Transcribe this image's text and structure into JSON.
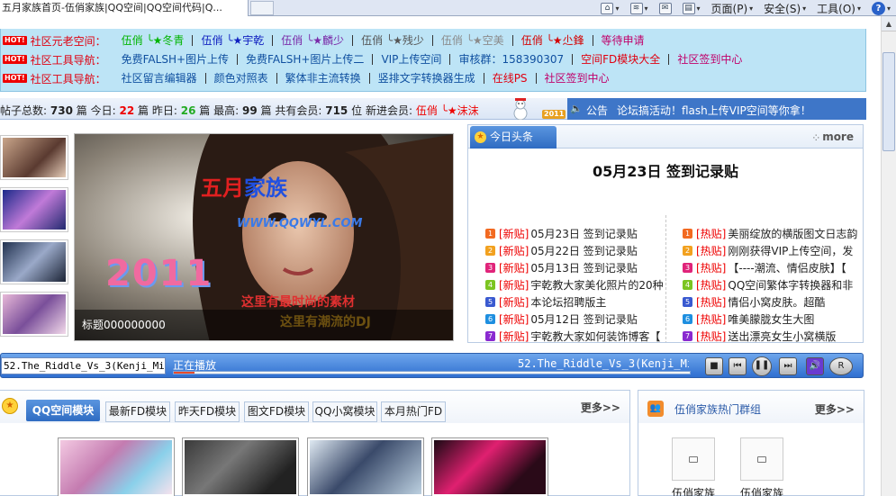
{
  "browser": {
    "tab_title": "五月家族首页-伍俏家族|QQ空间|QQ空间代码|Q...",
    "commands": {
      "home": "",
      "feeds": "",
      "read_mail": "",
      "print": "",
      "page": "页面(P)",
      "safety": "安全(S)",
      "tools": "工具(O)",
      "help": "?"
    }
  },
  "nav": {
    "hot_badge": "HOT!",
    "rows": [
      {
        "title": "社区元老空间：",
        "links": [
          {
            "text": "伍俏 ╰★冬青",
            "color": "#00b400"
          },
          {
            "text": "伍俏 ╰★宇乾",
            "color": "#1020c0"
          },
          {
            "text": "伍俏 ╰★麟少",
            "color": "#7a2aa8"
          },
          {
            "text": "伍俏 ╰★残少",
            "color": "#555555"
          },
          {
            "text": "伍俏 ╰★空美",
            "color": "#8a8a8a"
          },
          {
            "text": "伍俏 ╰★尐鋒",
            "color": "#d40000"
          },
          {
            "text": "等待申请",
            "color": "#c0006a"
          }
        ]
      },
      {
        "title": "社区工具导航：",
        "links": [
          {
            "text": "免费FALSH+图片上传",
            "color": "#1050a0"
          },
          {
            "text": "免费FALSH+图片上传二",
            "color": "#1050a0"
          },
          {
            "text": "VIP上传空间",
            "color": "#1050a0"
          },
          {
            "text": "审核群：158390307",
            "color": "#1050a0"
          },
          {
            "text": "空间FD模块大全",
            "color": "#e00010"
          },
          {
            "text": "社区签到中心",
            "color": "#c0006a"
          }
        ]
      },
      {
        "title": "社区工具导航：",
        "links": [
          {
            "text": "社区留言编辑器",
            "color": "#1050a0"
          },
          {
            "text": "颜色对照表",
            "color": "#1050a0"
          },
          {
            "text": "繁体非主流转换",
            "color": "#1050a0"
          },
          {
            "text": "竖排文字转换器生成",
            "color": "#1050a0"
          },
          {
            "text": "在线PS",
            "color": "#e00010"
          },
          {
            "text": "社区签到中心",
            "color": "#c0006a"
          }
        ]
      }
    ]
  },
  "stats": {
    "posts_label": "帖子总数:",
    "posts": "730",
    "posts_unit": "篇",
    "today_label": "今日:",
    "today": "22",
    "today_unit": "篇",
    "yesterday_label": "昨日:",
    "yesterday": "26",
    "yesterday_unit": "篇",
    "max_label": "最高:",
    "max": "99",
    "max_unit": "篇",
    "members_label": "共有会员:",
    "members": "715",
    "members_unit": "位",
    "newmember_label": "新进会员:",
    "newmember": "伍俏 ╰★沫沫"
  },
  "notice": {
    "label": "公告",
    "text": "论坛搞活动！flash上传VIP空间等你拿！"
  },
  "slideshow": {
    "caption": "标题000000000",
    "badge_year": "2011"
  },
  "headlines": {
    "tab_label": "今日头条",
    "more_label": "more",
    "feature": "05月23日 签到记录贴",
    "left": [
      {
        "num": "1",
        "color": "#f26a21",
        "tag": "[新贴]",
        "title": "05月23日 签到记录贴"
      },
      {
        "num": "2",
        "color": "#f2a11f",
        "tag": "[新贴]",
        "title": "05月22日 签到记录贴"
      },
      {
        "num": "3",
        "color": "#e0247a",
        "tag": "[新贴]",
        "title": "05月13日 签到记录贴"
      },
      {
        "num": "4",
        "color": "#7cc521",
        "tag": "[新贴]",
        "title": "宇乾教大家美化照片的20种"
      },
      {
        "num": "5",
        "color": "#3a5ad0",
        "tag": "[新贴]",
        "title": "本论坛招聘版主"
      },
      {
        "num": "6",
        "color": "#1e8fe0",
        "tag": "[新贴]",
        "title": "05月12日 签到记录贴"
      },
      {
        "num": "7",
        "color": "#8a2ad0",
        "tag": "[新贴]",
        "title": "宇乾教大家如何装饰博客【"
      }
    ],
    "right": [
      {
        "num": "1",
        "color": "#f26a21",
        "tag": "[热贴]",
        "title": "美丽绽放的横版图文日志韵"
      },
      {
        "num": "2",
        "color": "#f2a11f",
        "tag": "[热贴]",
        "title": "刚刚获得VIP上传空间，发"
      },
      {
        "num": "3",
        "color": "#e0247a",
        "tag": "[热贴]",
        "title": "【----潮流、情侣皮肤】【"
      },
      {
        "num": "4",
        "color": "#7cc521",
        "tag": "[热贴]",
        "title": "QQ空间繁体字转换器和非"
      },
      {
        "num": "5",
        "color": "#3a5ad0",
        "tag": "[热贴]",
        "title": "情侣小窝皮肤。超酷"
      },
      {
        "num": "6",
        "color": "#1e8fe0",
        "tag": "[热贴]",
        "title": "唯美朦胧女生大图"
      },
      {
        "num": "7",
        "color": "#8a2ad0",
        "tag": "[热贴]",
        "title": "送出漂亮女生小窝横版"
      }
    ]
  },
  "player": {
    "input_value": "52.The_Riddle_Vs_3(Kenji_Mix",
    "status": "正在播放",
    "track_title": "52.The_Riddle_Vs_3(Kenji_Mix)",
    "progress": 0.04
  },
  "modules": {
    "active_tab": "QQ空间模块",
    "tabs": [
      "最新FD模块",
      "昨天FD模块",
      "图文FD模块",
      "QQ小窝模块",
      "本月热门FD"
    ],
    "more_label": "更多>>"
  },
  "groups": {
    "title": "伍俏家族热门群组",
    "more_label": "更多>>",
    "items": [
      "伍俏家族",
      "伍俏家族"
    ]
  }
}
